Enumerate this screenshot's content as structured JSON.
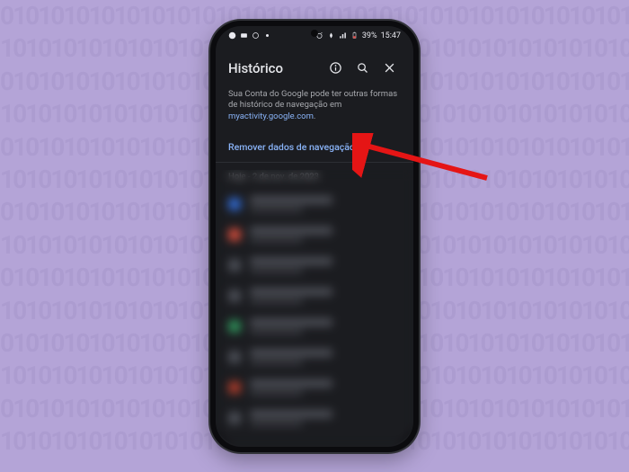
{
  "statusbar": {
    "battery_text": "39%",
    "time": "15:47"
  },
  "header": {
    "title": "Histórico"
  },
  "subtext": {
    "prefix": "Sua Conta do Google pode ter outras formas de histórico de navegação em ",
    "link": "myactivity.google.com",
    "suffix": "."
  },
  "clear_link": "Remover dados de navegação…",
  "date_label": "Hoje - 2 de nov. de 2023",
  "rows": [
    {
      "fav": "#3066c9"
    },
    {
      "fav": "#c94a3a"
    },
    {
      "fav": "#4a4d55"
    },
    {
      "fav": "#4a4d55"
    },
    {
      "fav": "#2e8b57"
    },
    {
      "fav": "#4a4d55"
    },
    {
      "fav": "#a33a2a"
    },
    {
      "fav": "#4a4d55"
    }
  ]
}
